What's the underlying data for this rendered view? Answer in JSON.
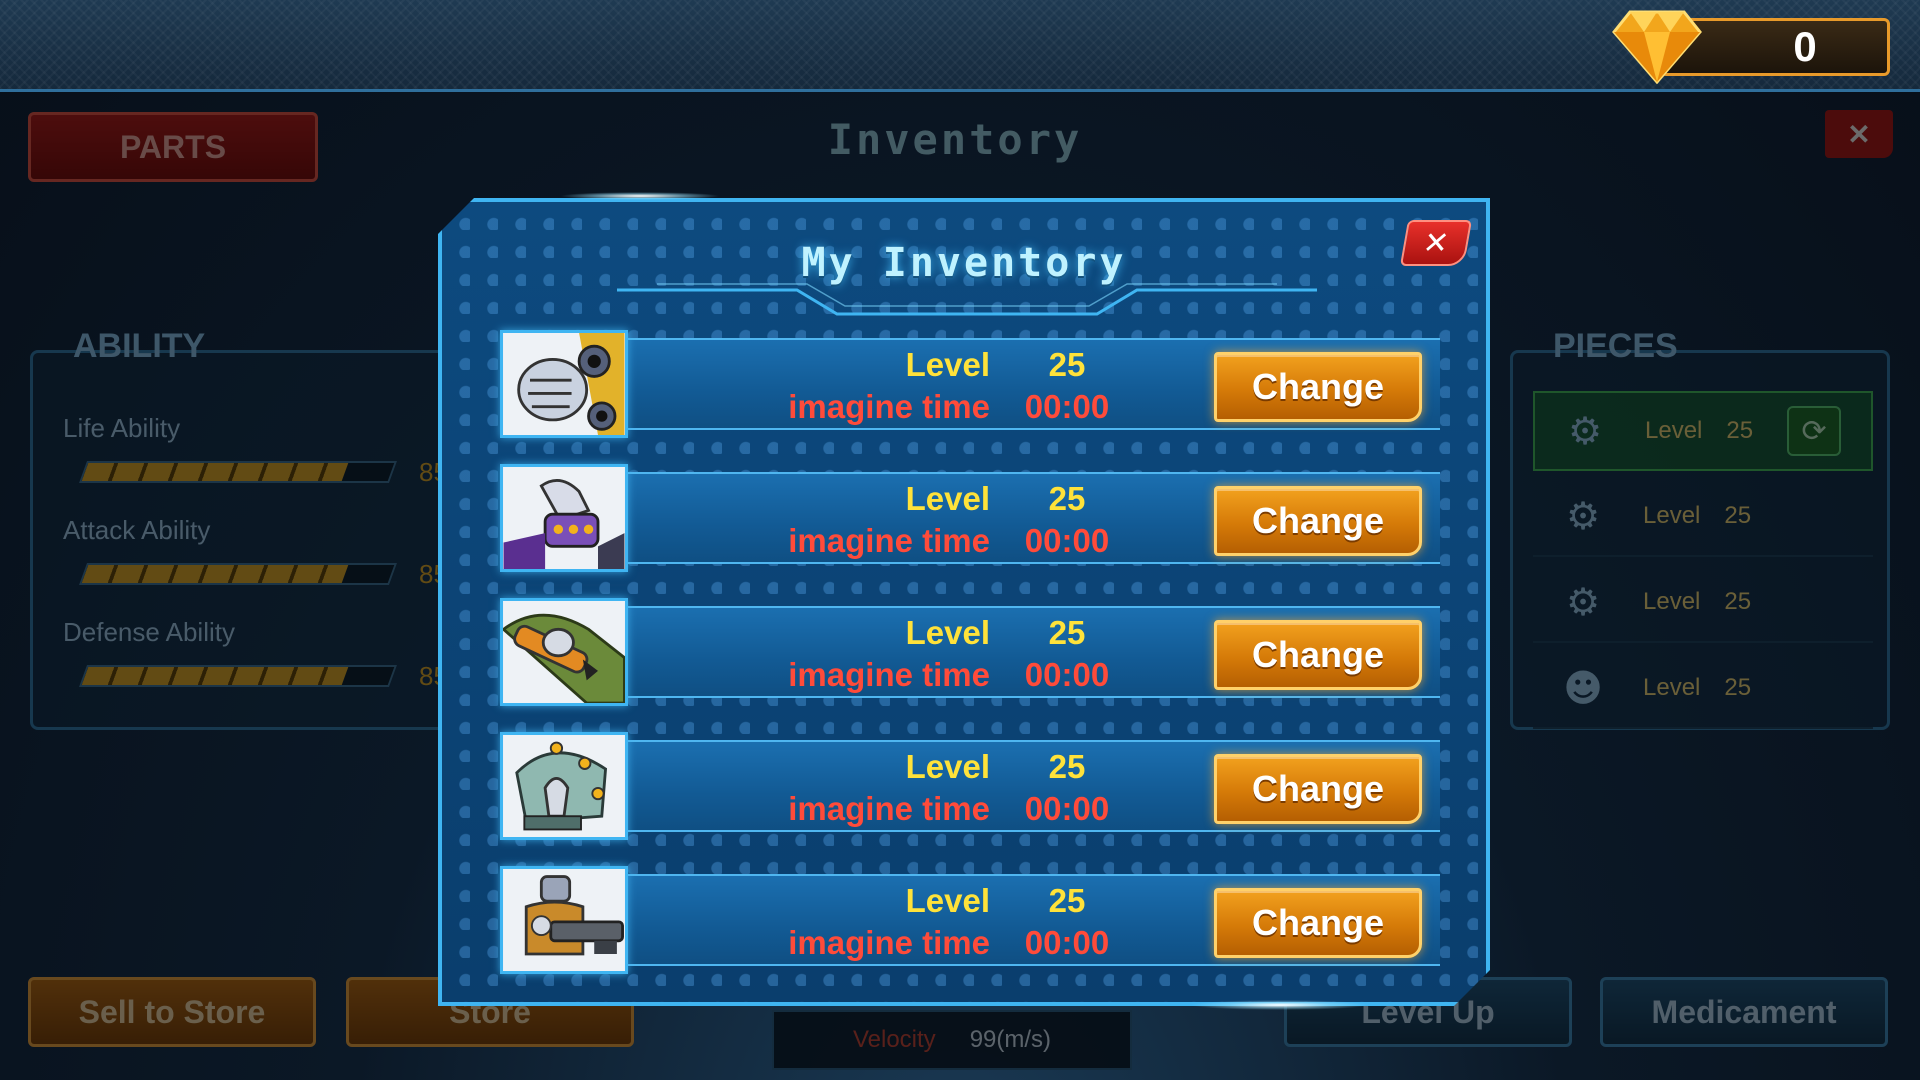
{
  "currency": {
    "gems": "0"
  },
  "background": {
    "screen_title": "Inventory",
    "parts_tab": "PARTS",
    "close_symbol": "✕",
    "ability": {
      "heading": "ABILITY",
      "items": [
        {
          "label": "Life Ability",
          "percent_text": "85%",
          "percent": 85
        },
        {
          "label": "Attack Ability",
          "percent_text": "85%",
          "percent": 85
        },
        {
          "label": "Defense Ability",
          "percent_text": "85%",
          "percent": 85
        }
      ]
    },
    "pieces": {
      "heading": "PIECES",
      "items": [
        {
          "icon": "robot-arm-icon",
          "level_label": "Level",
          "level": "25",
          "active": true
        },
        {
          "icon": "robot-leg-left-icon",
          "level_label": "Level",
          "level": "25",
          "active": false
        },
        {
          "icon": "robot-leg-right-icon",
          "level_label": "Level",
          "level": "25",
          "active": false
        },
        {
          "icon": "robot-head-icon",
          "level_label": "Level",
          "level": "25",
          "active": false
        }
      ]
    },
    "velocity": {
      "label": "Velocity",
      "value": "99(m/s)"
    },
    "buttons": {
      "sell": "Sell to Store",
      "store": "Store",
      "level_up": "Level Up",
      "medicament": "Medicament"
    }
  },
  "modal": {
    "title": "My Inventory",
    "close_symbol": "✕",
    "items": [
      {
        "thumb": "cannon-fist-part",
        "level_label": "Level",
        "level": "25",
        "time_label": "imagine time",
        "time": "00:00",
        "button": "Change"
      },
      {
        "thumb": "gauntlet-hand-part",
        "level_label": "Level",
        "level": "25",
        "time_label": "imagine time",
        "time": "00:00",
        "button": "Change"
      },
      {
        "thumb": "claw-arm-part",
        "level_label": "Level",
        "level": "25",
        "time_label": "imagine time",
        "time": "00:00",
        "button": "Change"
      },
      {
        "thumb": "drill-hand-part",
        "level_label": "Level",
        "level": "25",
        "time_label": "imagine time",
        "time": "00:00",
        "button": "Change"
      },
      {
        "thumb": "gun-robot-part",
        "level_label": "Level",
        "level": "25",
        "time_label": "imagine time",
        "time": "00:00",
        "button": "Change"
      }
    ]
  },
  "colors": {
    "modal_border": "#3fb5f2",
    "change_button": "#d57a08",
    "level_text": "#ffe23a",
    "time_text": "#ff4b3a",
    "close_button": "#e8302a"
  }
}
